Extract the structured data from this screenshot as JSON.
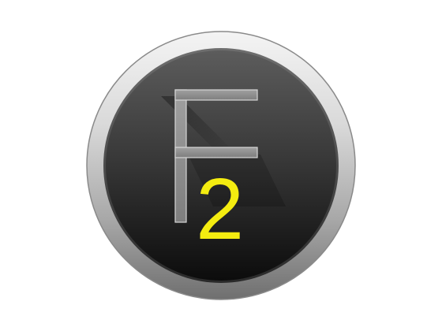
{
  "icon": {
    "name": "F2 app icon",
    "letter": "F",
    "number": "2",
    "colors": {
      "background": "#ffffff",
      "ring_light": "#f2f2f2",
      "ring_dark": "#6a6a6a",
      "face_top": "#5a5a5a",
      "face_bottom": "#0d0d0d",
      "letter_fill": "#8d8d8d",
      "letter_stroke": "#d8d8d8",
      "number_color": "#f4ec10"
    }
  }
}
